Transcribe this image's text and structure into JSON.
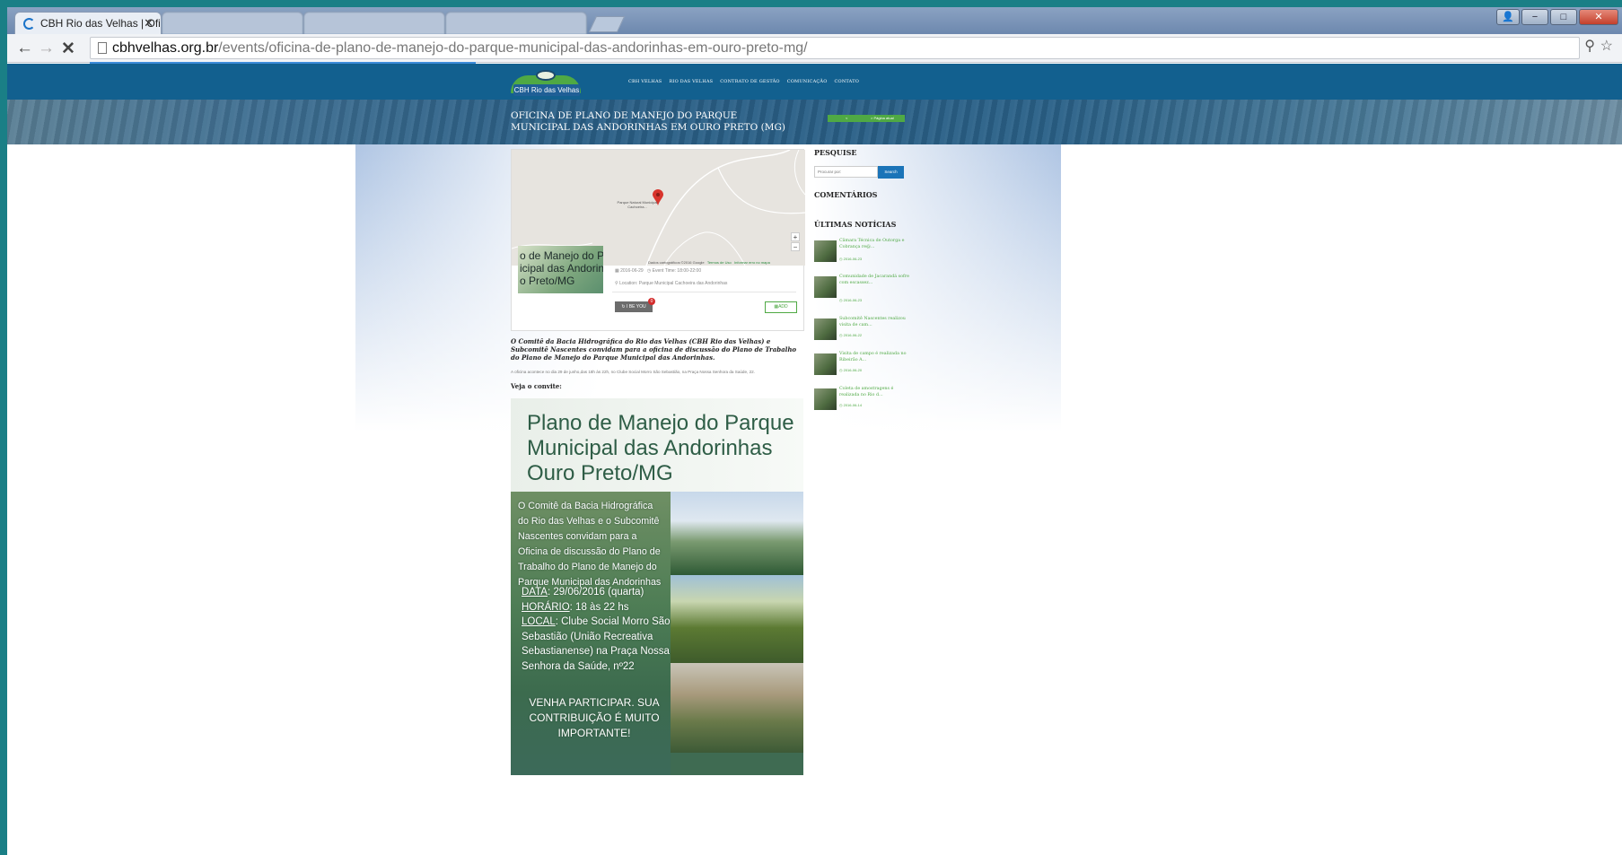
{
  "browser": {
    "active_tab": "CBH Rio das Velhas | Ofic",
    "tab_close": "✕",
    "url_domain": "cbhvelhas.org.br",
    "url_path": "/events/oficina-de-plano-de-manejo-do-parque-municipal-das-andorinhas-em-ouro-preto-mg/"
  },
  "site": {
    "logo_text": "CBH Rio das Velhas",
    "nav": [
      "CBH VELHAS",
      "RIO DAS VELHAS",
      "CONTRATO DE GESTÃO",
      "COMUNICAÇÃO",
      "CONTATO"
    ],
    "banner_title": "OFICINA DE PLANO DE MANEJO DO PARQUE MUNICIPAL DAS ANDORINHAS EM OURO PRETO (MG)",
    "crumb_prev": "<",
    "crumb_next": "> Página atual"
  },
  "event": {
    "map_place": "Parque Natural Municipal Cachoeira...",
    "map_attrib": "Dados cartográficos ©2016 Google",
    "map_terms": "Termos de Uso",
    "map_report": "Informar erro no mapa",
    "zoom_in": "+",
    "zoom_out": "−",
    "thumb_line1": "o de Manejo do Pa",
    "thumb_line2": "icipal das Andorinl",
    "thumb_line3": "o Preto/MG",
    "date": "2016-06-29",
    "time": "Event Time: 18:00-22:00",
    "location": "Location: Parque Municipal Cachoeira das Andorinhas",
    "ibeyou": "I BE YOU",
    "ibeyou_count": "0",
    "add": "ADD"
  },
  "article": {
    "lead": "O Comitê da Bacia Hidrográfica do Rio das Velhas (CBH Rio das Velhas) e Subcomitê Nascentes convidam para a oficina de discussão do Plano de Trabalho do Plano de Manejo do Parque Municipal das Andorinhas.",
    "info": "A oficina acontece no dia 29 de junho,das 18h às 22h, no Clube Social Morro São Sebastião, na Praça Nossa Senhora da Saúde, 22.",
    "veja": "Veja o convite:"
  },
  "poster": {
    "title_1": "Plano de Manejo do Parque",
    "title_2": "Municipal das Andorinhas",
    "title_3": "Ouro Preto/MG",
    "body": [
      "O Comitê da Bacia Hidrográfica",
      "do Rio das Velhas e o Subcomitê",
      "Nascentes convidam para a",
      "Oficina de discussão do Plano de",
      "Trabalho do Plano de Manejo do",
      "Parque Municipal das Andorinhas"
    ],
    "data_label": "DATA",
    "data_value": ": 29/06/2016 (quarta)",
    "horario_label": "HORÁRIO",
    "horario_value": ": 18 às 22 hs",
    "local_label": "LOCAL",
    "local_value": ": Clube Social Morro São Sebastião (União Recreativa Sebastianense) na Praça Nossa Senhora da Saúde, nº22",
    "cta": "VENHA PARTICIPAR. SUA CONTRIBUIÇÃO É MUITO IMPORTANTE!"
  },
  "sidebar": {
    "pesquise": "PESQUISE",
    "search_placeholder": "Procurar por:",
    "search_button": "Search",
    "comentarios": "COMENTÁRIOS",
    "ultimas": "ÚLTIMAS NOTÍCIAS",
    "news": [
      {
        "title": "Câmara Técnica de Outorga e Cobrança re@...",
        "date": "2016-06-23"
      },
      {
        "title": "Comunidade de Jacarandá sofre com escassez...",
        "date": "2016-06-23"
      },
      {
        "title": "Subcomitê Nascentes realizou visita de cam...",
        "date": "2016-06-22"
      },
      {
        "title": "Visita de campo é realizada no Ribeirão A...",
        "date": "2016-06-20"
      },
      {
        "title": "Coleta de amostragens é realizada no Rio d...",
        "date": "2016-06-14"
      }
    ]
  }
}
